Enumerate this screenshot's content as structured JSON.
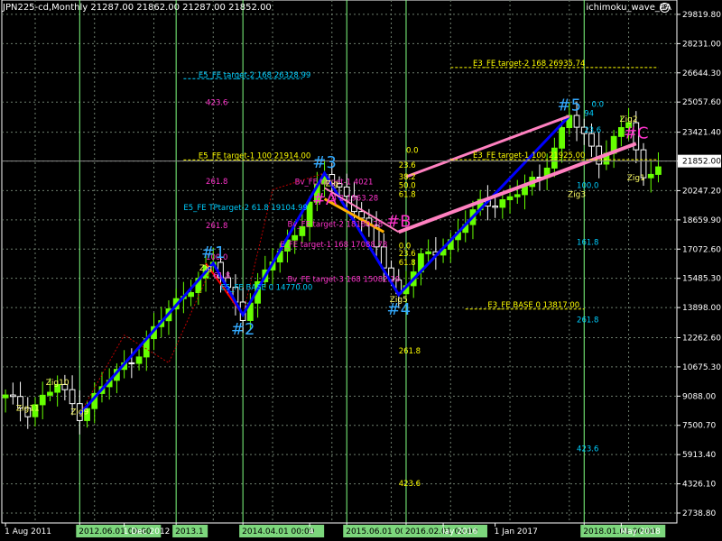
{
  "header": {
    "symbol_line": "JPN225-cd,Monthly  21287.00 21862.00 21287.00 21852.00",
    "ea_name": "ichimoku_wave_EA",
    "ea_icon": "smiley-icon"
  },
  "chart_data": {
    "type": "candlestick",
    "ylim": [
      2200,
      30600
    ],
    "y_ticks": [
      "29819.80",
      "28231.00",
      "26644.30",
      "25057.60",
      "23421.40",
      "21852.00",
      "20247.20",
      "18659.90",
      "17072.60",
      "15485.30",
      "13898.00",
      "12262.60",
      "10675.30",
      "9088.00",
      "7500.70",
      "5913.40",
      "4326.10",
      "2738.80"
    ],
    "y_tick_values": [
      29819.8,
      28231.0,
      26644.3,
      25057.6,
      23421.4,
      21852.0,
      20247.2,
      18659.9,
      17072.6,
      15485.3,
      13898.0,
      12262.6,
      10675.3,
      9088.0,
      7500.7,
      5913.4,
      4326.1,
      2738.8
    ],
    "current_price": "21852.00",
    "current_price_value": 21852,
    "x_ticks": [
      {
        "label": "1 Aug 2011",
        "bar": 0,
        "highlight": false
      },
      {
        "label": "2012.06.01 00:00",
        "bar": 10,
        "highlight": true
      },
      {
        "label": "1 Dec 2012",
        "bar": 16,
        "highlight": false
      },
      {
        "label": "2013.1",
        "bar": 23,
        "highlight": true
      },
      {
        "label": "2014.04.01 00:00",
        "bar": 32,
        "highlight": true
      },
      {
        "label": "4",
        "bar": 41,
        "highlight": false
      },
      {
        "label": "2015.06.01 00:00",
        "bar": 46,
        "highlight": true
      },
      {
        "label": "2016.02.01 00:00",
        "bar": 54,
        "highlight": true
      },
      {
        "label": "lay 2016",
        "bar": 59,
        "highlight": false
      },
      {
        "label": "1 Jan 2017",
        "bar": 66,
        "highlight": false
      },
      {
        "label": "2018.01.01 00:00",
        "bar": 78,
        "highlight": true
      },
      {
        "label": "May 2018",
        "bar": 83,
        "highlight": false
      }
    ],
    "vlines_bars": [
      10,
      23,
      32,
      46,
      54,
      78
    ],
    "candles_start": 2011.58,
    "waves": [
      {
        "label": "#1",
        "bar": 28,
        "price": 16300
      },
      {
        "label": "#2",
        "bar": 32,
        "price": 13500
      },
      {
        "label": "#3",
        "bar": 43,
        "price": 21200
      },
      {
        "label": "#4",
        "bar": 53,
        "price": 14600
      },
      {
        "label": "#5",
        "bar": 76,
        "price": 24300
      },
      {
        "label": "#A",
        "bar": 43,
        "price": 19200
      },
      {
        "label": "#B",
        "bar": 53,
        "price": 18000
      },
      {
        "label": "#C",
        "bar": 85,
        "price": 22800
      }
    ],
    "zig_labels": [
      {
        "label": "Zig11",
        "bar": 3,
        "price": 8300
      },
      {
        "label": "Zig10",
        "bar": 7,
        "price": 9700
      },
      {
        "label": "Zig9",
        "bar": 10,
        "price": 8100
      },
      {
        "label": "Zig2",
        "bar": 84,
        "price": 24000
      },
      {
        "label": "Zig1",
        "bar": 85,
        "price": 20800
      },
      {
        "label": "Zig3",
        "bar": 77,
        "price": 19900
      },
      {
        "label": "Zig5",
        "bar": 53,
        "price": 14200
      },
      {
        "label": "Zig",
        "bar": 44,
        "price": 20500
      },
      {
        "label": "Zig",
        "bar": 27,
        "price": 15900
      }
    ],
    "fibo_texts": [
      {
        "text": "E5_FE target-2 168 26328.99",
        "bar": 26,
        "price": 26300,
        "color": "#00cfff"
      },
      {
        "text": "E3_FE target-2 168 26935.74",
        "bar": 63,
        "price": 26935,
        "color": "#ffff00"
      },
      {
        "text": "E5_FE target-1 100 21914.00",
        "bar": 26,
        "price": 21914,
        "color": "#ffff00"
      },
      {
        "text": "E3_FE target-1 100 21925.00",
        "bar": 63,
        "price": 21925,
        "color": "#ffff00"
      },
      {
        "text": "E5_FE TPtarget-2 61.8 19104.99",
        "bar": 24,
        "price": 19104,
        "color": "#00cfff"
      },
      {
        "text": "E5_FE BASE 0 14770.00",
        "bar": 29,
        "price": 14770,
        "color": "#00cfff"
      },
      {
        "text": "E3_FE BASE 0 13817.00",
        "bar": 65,
        "price": 13817,
        "color": "#ffff00"
      },
      {
        "text": "E_FE target-1 168 17088.78",
        "bar": 37,
        "price": 17088,
        "color": "#ff33cc"
      },
      {
        "text": "Bv_FE target-3 168 15082.16",
        "bar": 38,
        "price": 15200,
        "color": "#ff33cc"
      },
      {
        "text": "Bv_FE target-1 4021",
        "bar": 39,
        "price": 20500,
        "color": "#ff33cc"
      },
      {
        "text": "Bv_FE target-2 18180.28",
        "bar": 38,
        "price": 18180,
        "color": "#ff33cc"
      },
      {
        "text": "4 2 1963.28",
        "bar": 44,
        "price": 19600,
        "color": "#ff33cc"
      }
    ],
    "fibo_levels": [
      {
        "text": "423.6",
        "bar": 27,
        "price": 24900,
        "color": "#ff33cc"
      },
      {
        "text": "261.8",
        "bar": 27,
        "price": 20600,
        "color": "#ff33cc"
      },
      {
        "text": "261.8",
        "bar": 27,
        "price": 18200,
        "color": "#ff33cc"
      },
      {
        "text": "100.0",
        "bar": 27,
        "price": 16500,
        "color": "#ff33cc"
      },
      {
        "text": "61.8",
        "bar": 28,
        "price": 15500,
        "color": "#ff33cc"
      },
      {
        "text": "0.0",
        "bar": 54,
        "price": 22300,
        "color": "#ffff00"
      },
      {
        "text": "23.6",
        "bar": 53,
        "price": 21500,
        "color": "#ffff00"
      },
      {
        "text": "38.2",
        "bar": 53,
        "price": 20850,
        "color": "#ffff00"
      },
      {
        "text": "50.0",
        "bar": 53,
        "price": 20400,
        "color": "#ffff00"
      },
      {
        "text": "61.8",
        "bar": 53,
        "price": 19900,
        "color": "#ffff00"
      },
      {
        "text": "0.0",
        "bar": 53,
        "price": 17100,
        "color": "#ffff00"
      },
      {
        "text": "23.6",
        "bar": 53,
        "price": 16700,
        "color": "#ffff00"
      },
      {
        "text": "61.8",
        "bar": 53,
        "price": 16200,
        "color": "#ffff00"
      },
      {
        "text": "261.8",
        "bar": 53,
        "price": 11400,
        "color": "#ffff00"
      },
      {
        "text": "423.6",
        "bar": 53,
        "price": 4200,
        "color": "#ffff00"
      },
      {
        "text": "0.0",
        "bar": 79,
        "price": 24800,
        "color": "#00cfff"
      },
      {
        "text": "23.6",
        "bar": 78,
        "price": 23400,
        "color": "#00cfff"
      },
      {
        "text": "94",
        "bar": 78,
        "price": 24300,
        "color": "#00cfff"
      },
      {
        "text": "100.0",
        "bar": 77,
        "price": 20400,
        "color": "#00cfff"
      },
      {
        "text": "161.8",
        "bar": 77,
        "price": 17300,
        "color": "#00cfff"
      },
      {
        "text": "261.8",
        "bar": 77,
        "price": 13100,
        "color": "#00cfff"
      },
      {
        "text": "423.6",
        "bar": 77,
        "price": 6100,
        "color": "#00cfff"
      }
    ],
    "main_wave": [
      [
        10,
        8100
      ],
      [
        28,
        16300
      ],
      [
        32,
        13500
      ],
      [
        43,
        21200
      ],
      [
        53,
        14600
      ],
      [
        76,
        24300
      ]
    ],
    "abc_line_top": [
      [
        54,
        21000
      ],
      [
        76,
        24300
      ]
    ],
    "abc_line_bottom": [
      [
        53,
        18000
      ],
      [
        85,
        22800
      ]
    ],
    "red_legs": [
      [
        27,
        16300
      ],
      [
        32,
        13500
      ],
      [
        43,
        21200
      ],
      [
        53,
        14600
      ]
    ]
  },
  "colors": {
    "background": "#000000",
    "grid": "#6e7e6e",
    "bull": "#66ff00",
    "bear": "#ffffff",
    "wave": "#0000ff",
    "abc": "#ff80c0",
    "vline": "#80ff80",
    "axis_text": "#ffffff"
  }
}
